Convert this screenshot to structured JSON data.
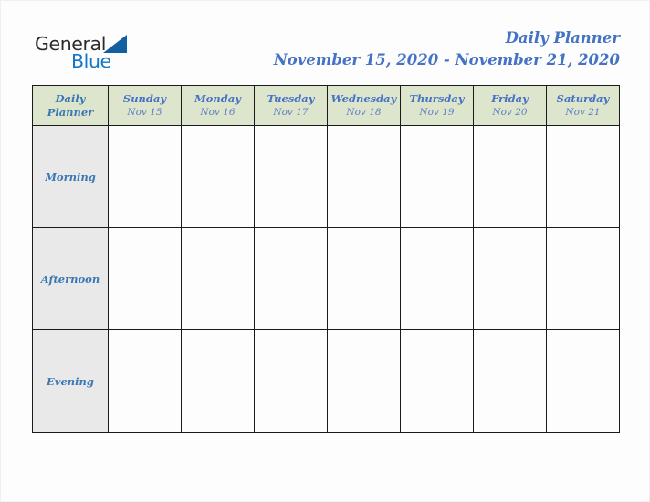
{
  "brand": {
    "name_part1": "General",
    "name_part2": "Blue",
    "triangle_icon": "triangle-icon",
    "color_dark": "#2b2b2b",
    "color_blue": "#1476c6",
    "color_triangle": "#12609f"
  },
  "header": {
    "title": "Daily Planner",
    "date_range": "November 15, 2020 - November 21, 2020",
    "title_color": "#4472c4"
  },
  "table": {
    "corner": {
      "line1": "Daily",
      "line2": "Planner"
    },
    "header_bg": "#dde5cc",
    "row_label_bg": "#e9e9e9",
    "border_color": "#1a1a1a",
    "columns": [
      {
        "day": "Sunday",
        "date": "Nov 15"
      },
      {
        "day": "Monday",
        "date": "Nov 16"
      },
      {
        "day": "Tuesday",
        "date": "Nov 17"
      },
      {
        "day": "Wednesday",
        "date": "Nov 18"
      },
      {
        "day": "Thursday",
        "date": "Nov 19"
      },
      {
        "day": "Friday",
        "date": "Nov 20"
      },
      {
        "day": "Saturday",
        "date": "Nov 21"
      }
    ],
    "rows": [
      {
        "label": "Morning",
        "cells": [
          "",
          "",
          "",
          "",
          "",
          "",
          ""
        ]
      },
      {
        "label": "Afternoon",
        "cells": [
          "",
          "",
          "",
          "",
          "",
          "",
          ""
        ]
      },
      {
        "label": "Evening",
        "cells": [
          "",
          "",
          "",
          "",
          "",
          "",
          ""
        ]
      }
    ]
  }
}
